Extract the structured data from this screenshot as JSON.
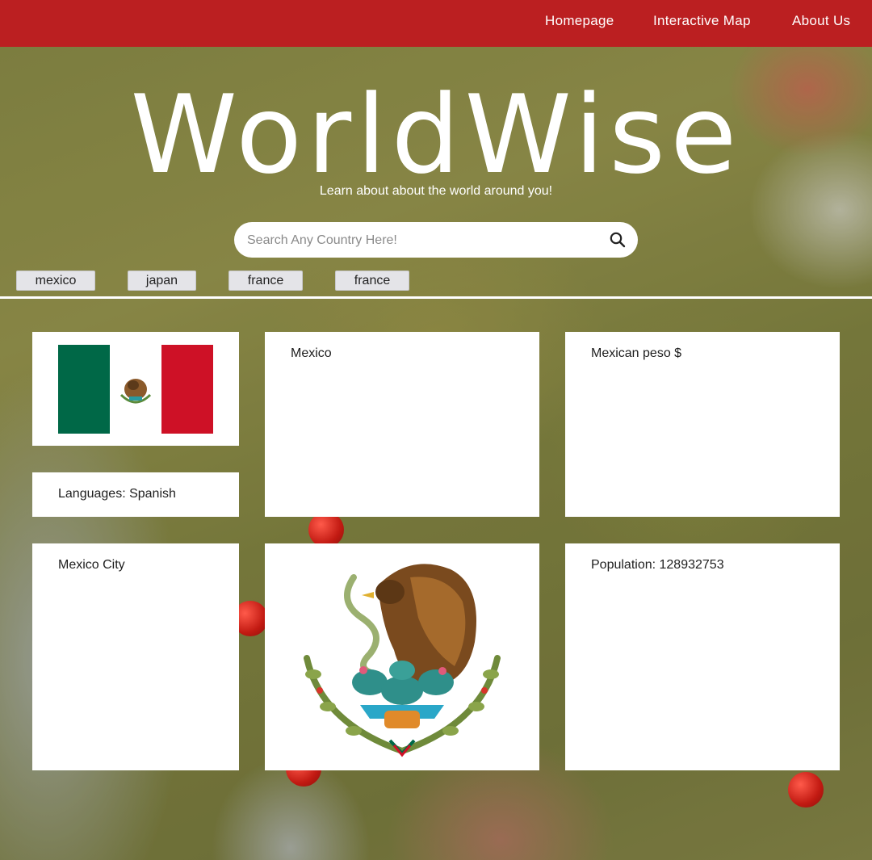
{
  "nav": {
    "links": [
      "Homepage",
      "Interactive Map",
      "About Us"
    ]
  },
  "hero": {
    "title": "WorldWise",
    "subtitle": "Learn about about the world around you!",
    "search_placeholder": "Search Any Country Here!",
    "search_icon": "search-icon"
  },
  "recent_searches": [
    "mexico",
    "japan",
    "france",
    "france"
  ],
  "country": {
    "name": "Mexico",
    "currency": "Mexican peso $",
    "languages": "Languages: Spanish",
    "capital": "Mexico City",
    "population": "Population: 128932753"
  },
  "colors": {
    "nav_bg": "#bb1f21",
    "flag_green": "#006847",
    "flag_white": "#ffffff",
    "flag_red": "#ce1126"
  }
}
